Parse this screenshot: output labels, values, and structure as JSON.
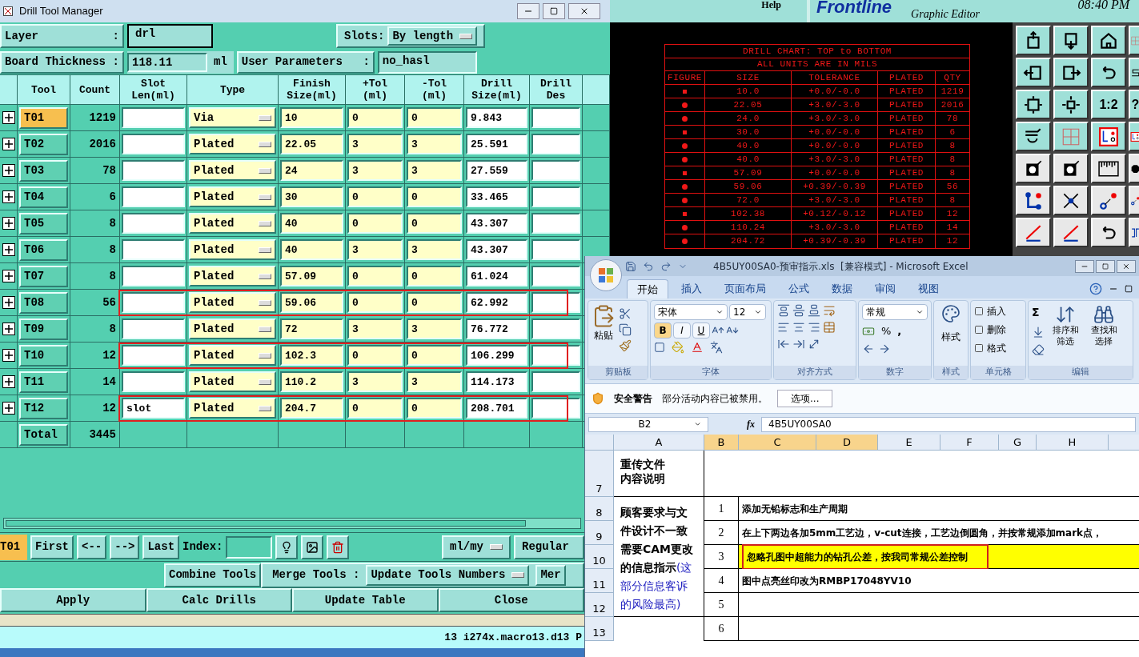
{
  "drill_manager": {
    "title": "Drill Tool Manager",
    "layer": {
      "label": "Layer",
      "colon": ":",
      "value": "drl"
    },
    "slots": {
      "label": "Slots:",
      "value": "By length"
    },
    "board_thickness": {
      "label": "Board Thickness",
      "colon": ":",
      "value": "118.11",
      "unit": "ml"
    },
    "user_parameters": {
      "label": "User Parameters",
      "colon": ":",
      "value": "no_hasl"
    },
    "columns": [
      "Tool",
      "Count",
      "Slot Len(ml)",
      "Type",
      "Finish Size(ml)",
      "+Tol (ml)",
      "-Tol (ml)",
      "Drill Size(ml)",
      "Drill Des"
    ],
    "rows": [
      {
        "tool": "T01",
        "selected": true,
        "count": "1219",
        "type": "Via",
        "finish": "10",
        "plus_tol": "0",
        "minus_tol": "0",
        "drill_size": "9.843",
        "highlighted": false
      },
      {
        "tool": "T02",
        "selected": false,
        "count": "2016",
        "type": "Plated",
        "finish": "22.05",
        "plus_tol": "3",
        "minus_tol": "3",
        "drill_size": "25.591",
        "highlighted": false
      },
      {
        "tool": "T03",
        "selected": false,
        "count": "78",
        "type": "Plated",
        "finish": "24",
        "plus_tol": "3",
        "minus_tol": "3",
        "drill_size": "27.559",
        "highlighted": false
      },
      {
        "tool": "T04",
        "selected": false,
        "count": "6",
        "type": "Plated",
        "finish": "30",
        "plus_tol": "0",
        "minus_tol": "0",
        "drill_size": "33.465",
        "highlighted": false
      },
      {
        "tool": "T05",
        "selected": false,
        "count": "8",
        "type": "Plated",
        "finish": "40",
        "plus_tol": "0",
        "minus_tol": "0",
        "drill_size": "43.307",
        "highlighted": false
      },
      {
        "tool": "T06",
        "selected": false,
        "count": "8",
        "type": "Plated",
        "finish": "40",
        "plus_tol": "3",
        "minus_tol": "3",
        "drill_size": "43.307",
        "highlighted": false
      },
      {
        "tool": "T07",
        "selected": false,
        "count": "8",
        "type": "Plated",
        "finish": "57.09",
        "plus_tol": "0",
        "minus_tol": "0",
        "drill_size": "61.024",
        "highlighted": false
      },
      {
        "tool": "T08",
        "selected": false,
        "count": "56",
        "type": "Plated",
        "finish": "59.06",
        "plus_tol": "0",
        "minus_tol": "0",
        "drill_size": "62.992",
        "highlighted": true
      },
      {
        "tool": "T09",
        "selected": false,
        "count": "8",
        "type": "Plated",
        "finish": "72",
        "plus_tol": "3",
        "minus_tol": "3",
        "drill_size": "76.772",
        "highlighted": false
      },
      {
        "tool": "T10",
        "selected": false,
        "count": "12",
        "type": "Plated",
        "finish": "102.3",
        "plus_tol": "0",
        "minus_tol": "0",
        "drill_size": "106.299",
        "highlighted": true
      },
      {
        "tool": "T11",
        "selected": false,
        "count": "14",
        "type": "Plated",
        "finish": "110.2",
        "plus_tol": "3",
        "minus_tol": "3",
        "drill_size": "114.173",
        "highlighted": false
      },
      {
        "tool": "T12",
        "selected": false,
        "count": "12",
        "slot_len": "slot",
        "type": "Plated",
        "finish": "204.7",
        "plus_tol": "0",
        "minus_tol": "0",
        "drill_size": "208.701",
        "highlighted": true
      }
    ],
    "total": {
      "label": "Total",
      "count": "3445"
    },
    "nav": {
      "current": "T01",
      "buttons": [
        "First",
        "<--",
        "-->",
        "Last"
      ],
      "index_label": "Index:",
      "units": "ml/my",
      "mode": "Regular"
    },
    "merge": {
      "combine": "Combine Tools",
      "label": "Merge Tools :",
      "value": "Update Tools Numbers",
      "more": "Mer"
    },
    "actions": [
      "Apply",
      "Calc Drills",
      "Update Table",
      "Close"
    ],
    "status": "13 i274x.macro13.d13 P"
  },
  "cad": {
    "help": "Help",
    "logo": "Frontline",
    "subtitle": "Graphic Editor",
    "time": "08:40 PM",
    "chart_title": "DRILL CHART: TOP to BOTTOM",
    "chart_subtitle": "ALL UNITS ARE IN MILS",
    "chart_columns": [
      "FIGURE",
      "SIZE",
      "TOLERANCE",
      "PLATED",
      "QTY"
    ],
    "chart_rows": [
      {
        "size": "10.0",
        "tolerance": "+0.0/-0.0",
        "plated": "PLATED",
        "qty": "1219"
      },
      {
        "size": "22.05",
        "tolerance": "+3.0/-3.0",
        "plated": "PLATED",
        "qty": "2016"
      },
      {
        "size": "24.0",
        "tolerance": "+3.0/-3.0",
        "plated": "PLATED",
        "qty": "78"
      },
      {
        "size": "30.0",
        "tolerance": "+0.0/-0.0",
        "plated": "PLATED",
        "qty": "6"
      },
      {
        "size": "40.0",
        "tolerance": "+0.0/-0.0",
        "plated": "PLATED",
        "qty": "8"
      },
      {
        "size": "40.0",
        "tolerance": "+3.0/-3.0",
        "plated": "PLATED",
        "qty": "8"
      },
      {
        "size": "57.09",
        "tolerance": "+0.0/-0.0",
        "plated": "PLATED",
        "qty": "8"
      },
      {
        "size": "59.06",
        "tolerance": "+0.39/-0.39",
        "plated": "PLATED",
        "qty": "56"
      },
      {
        "size": "72.0",
        "tolerance": "+3.0/-3.0",
        "plated": "PLATED",
        "qty": "8"
      },
      {
        "size": "102.38",
        "tolerance": "+0.12/-0.12",
        "plated": "PLATED",
        "qty": "12"
      },
      {
        "size": "110.24",
        "tolerance": "+3.0/-3.0",
        "plated": "PLATED",
        "qty": "14"
      },
      {
        "size": "204.72",
        "tolerance": "+0.39/-0.39",
        "plated": "PLATED",
        "qty": "12"
      }
    ],
    "toolbar_labels": [
      "1:2",
      "?"
    ]
  },
  "excel": {
    "title": "4B5UY00SA0-预审指示.xls  [兼容模式] - Microsoft Excel",
    "tabs": [
      {
        "label": "开始",
        "selected": true
      },
      {
        "label": "插入",
        "selected": false
      },
      {
        "label": "页面布局",
        "selected": false
      },
      {
        "label": "公式",
        "selected": false
      },
      {
        "label": "数据",
        "selected": false
      },
      {
        "label": "审阅",
        "selected": false
      },
      {
        "label": "视图",
        "selected": false
      }
    ],
    "ribbon": {
      "paste": "粘贴",
      "font": "宋体",
      "size": "12",
      "font_buttons": [
        "B",
        "I",
        "U"
      ],
      "number_format": "常规",
      "percent": "%",
      "comma": ",",
      "styles": "样式",
      "cells": [
        "插入",
        "删除",
        "格式"
      ],
      "sum": "Σ",
      "sort": "排序和筛选",
      "find": "查找和选择",
      "groups": [
        "剪贴板",
        "字体",
        "对齐方式",
        "数字",
        "样式",
        "单元格",
        "编辑"
      ]
    },
    "security": {
      "title": "安全警告",
      "message": "部分活动内容已被禁用。",
      "button": "选项..."
    },
    "name_box": "B2",
    "function_label": "fx",
    "formula": "4B5UY00SA0",
    "columns": [
      {
        "label": "A",
        "selected": false
      },
      {
        "label": "B",
        "selected": true
      },
      {
        "label": "C",
        "selected": true
      },
      {
        "label": "D",
        "selected": true
      },
      {
        "label": "E",
        "selected": false
      },
      {
        "label": "F",
        "selected": false
      },
      {
        "label": "G",
        "selected": false
      },
      {
        "label": "H",
        "selected": false
      }
    ],
    "row_numbers": [
      "7",
      "8",
      "9",
      "10",
      "11",
      "12",
      "13"
    ],
    "heading": [
      "重传文件",
      "内容说明"
    ],
    "notice": "顾客要求与文件设计不一致需要CAM更改的信息指示",
    "notice_note": "(这部分信息客诉的风险最高)",
    "items": [
      {
        "item": "1",
        "text": "添加无铅标志和生产周期",
        "highlighted": false
      },
      {
        "item": "2",
        "text": "在上下两边各加5mm工艺边，v-cut连接，工艺边倒圆角，并按常规添加mark点，",
        "highlighted": false
      },
      {
        "item": "3",
        "text": "忽略孔图中超能力的钻孔公差，按我司常规公差控制",
        "highlighted": true
      },
      {
        "item": "4",
        "text": "图中点亮丝印改为RMBP17048YV10",
        "highlighted": false
      },
      {
        "item": "5",
        "highlighted": false
      },
      {
        "item": "6",
        "highlighted": false
      }
    ]
  }
}
